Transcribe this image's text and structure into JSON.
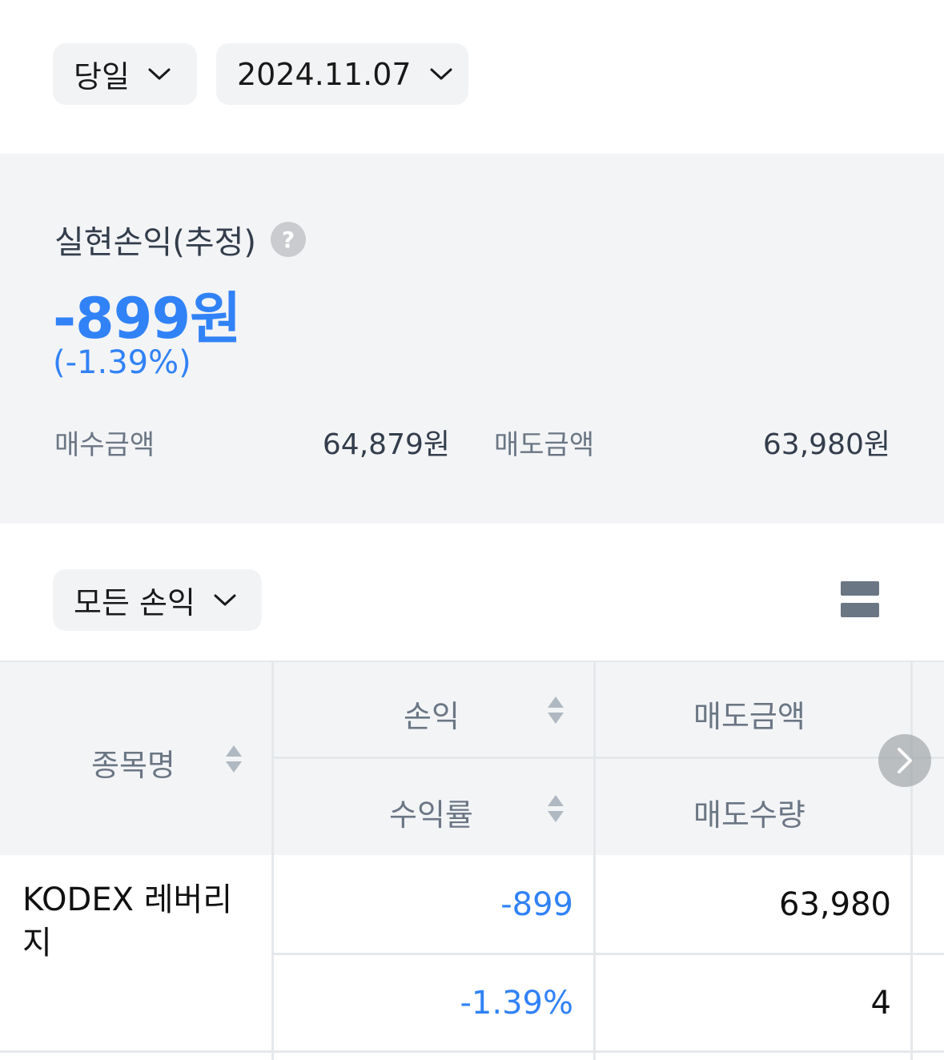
{
  "filters": {
    "period": "당일",
    "date": "2024.11.07"
  },
  "summary": {
    "title": "실현손익(추정)",
    "help_icon": "?",
    "profit_amount": "-899원",
    "profit_rate": "(-1.39%)",
    "buy_label": "매수금액",
    "buy_value": "64,879원",
    "sell_label": "매도금액",
    "sell_value": "63,980원"
  },
  "list_filter": {
    "label": "모든 손익"
  },
  "table": {
    "headers": {
      "name": "종목명",
      "profit": "손익",
      "return_rate": "수익률",
      "sell_amount": "매도금액",
      "sell_quantity": "매도수량"
    },
    "rows": [
      {
        "name": "KODEX 레버리지",
        "profit": "-899",
        "return_rate": "-1.39%",
        "sell_amount": "63,980",
        "sell_quantity": "4"
      }
    ]
  },
  "colors": {
    "accent_blue": "#3182f6",
    "chip_bg": "#f2f3f5",
    "summary_bg": "#f3f4f6",
    "label_gray": "#6b7684"
  },
  "icons": {
    "dropdown": "chevron-down-icon",
    "help": "question-circle-icon",
    "layout": "layout-toggle-icon",
    "sort": "sort-updown-icon",
    "scroll": "chevron-right-icon"
  }
}
